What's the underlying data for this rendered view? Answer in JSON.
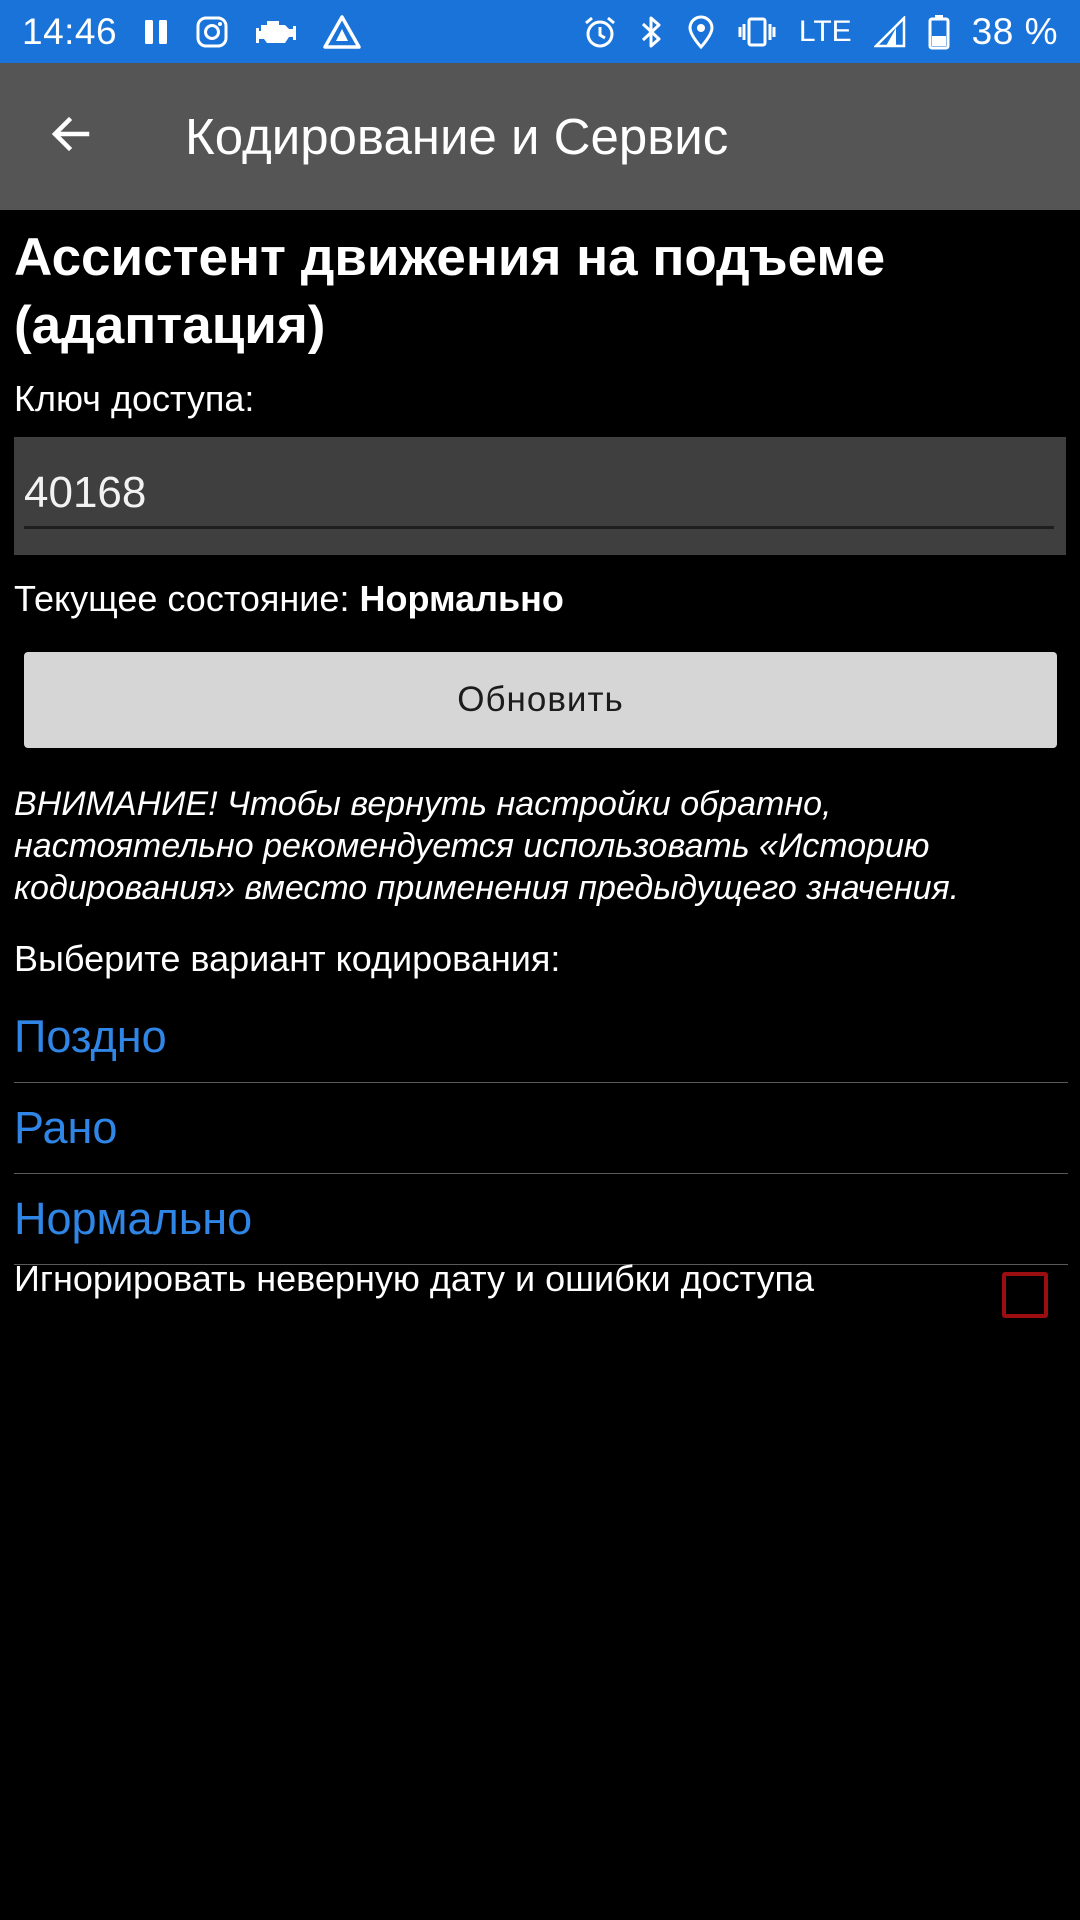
{
  "status_bar": {
    "time": "14:46",
    "network": "LTE",
    "battery": "38 %",
    "left_icons": [
      "pause-icon",
      "instagram-icon",
      "engine-icon",
      "navigation-icon"
    ],
    "right_icons": [
      "alarm-icon",
      "bluetooth-icon",
      "location-icon",
      "vibrate-icon",
      "signal-icon",
      "battery-icon"
    ]
  },
  "toolbar": {
    "title": "Кодирование и Сервис",
    "back_icon": "arrow-back-icon"
  },
  "page": {
    "title": "Ассистент движения на подъеме (адаптация)",
    "access_key_label": "Ключ доступа:",
    "access_key_value": "40168",
    "state_prefix": "Текущее состояние:",
    "state_value": "Нормально",
    "refresh_button": "Обновить",
    "warning": "ВНИМАНИЕ! Чтобы вернуть настройки обратно, настоятельно рекомендуется использовать «Историю кодирования» вместо применения предыдущего значения.",
    "choose_label": "Выберите вариант кодирования:",
    "options": [
      {
        "label": "Поздно"
      },
      {
        "label": "Рано"
      },
      {
        "label": "Нормально"
      }
    ],
    "ignore_label": "Игнорировать неверную дату и ошибки доступа",
    "ignore_checked": false
  },
  "colors": {
    "status_bar": "#1a73d9",
    "toolbar": "#555555",
    "background": "#000000",
    "option_text": "#2f86e6",
    "checkbox_border": "#9a0e12"
  }
}
